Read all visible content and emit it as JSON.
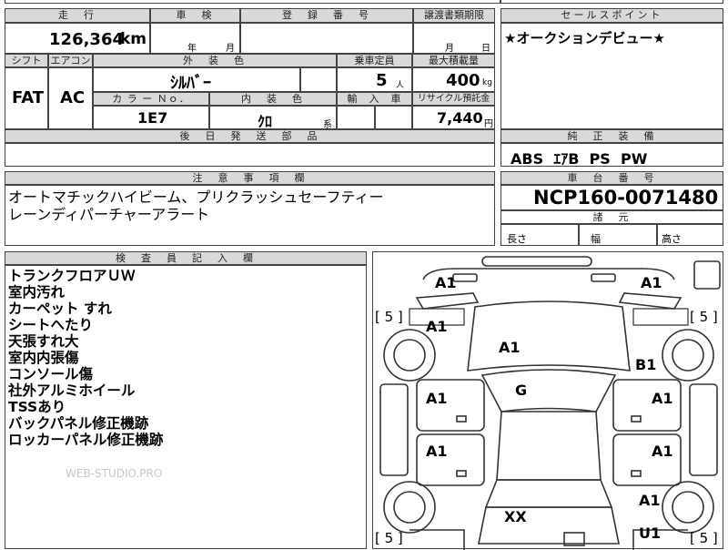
{
  "top_row": {
    "mileage_hdr": "走　行",
    "mileage_value": "126,364",
    "mileage_unit": "km",
    "shaken_hdr": "車　検",
    "shaken_year": "年",
    "shaken_month": "月",
    "reg_hdr": "登　録　番　号",
    "transfer_hdr": "譲渡書類期限",
    "transfer_month": "月",
    "transfer_day": "日"
  },
  "spec_row": {
    "shift_hdr": "シフト",
    "shift": "FAT",
    "ac_hdr": "エアコン",
    "ac": "AC",
    "ext_color_hdr": "外　装　色",
    "ext_color": "ｼﾙﾊﾞｰ",
    "seats_hdr": "乗車定員",
    "seats": "5",
    "seats_unit": "人",
    "load_hdr": "最大積載量",
    "load": "400",
    "load_unit": "kg",
    "color_no_hdr": "カ ラ ー Ｎｏ．",
    "color_no": "1E7",
    "int_color_hdr": "内　装　色",
    "int_color": "ｸﾛ",
    "int_color_unit": "系",
    "import_hdr": "輸　入　車",
    "recycle_hdr": "リサイクル預託金",
    "recycle": "7,440",
    "recycle_unit": "円",
    "parts_hdr": "後　日　発　送　部　品"
  },
  "sales_point": {
    "hdr": "セールスポイント",
    "text": "★オークションデビュー★"
  },
  "equipment": {
    "hdr": "純　正　装　備",
    "text": "ABS  ｴｱB  PS  PW"
  },
  "notes": {
    "hdr": "注　意　事　項　欄",
    "text": "オートマチックハイビーム、プリクラッシュセーフティー\nレーンディパーチャーアラート"
  },
  "chassis": {
    "hdr": "車　台　番　号",
    "value": "NCP160-0071480"
  },
  "dims": {
    "hdr": "諸　元",
    "length": "長さ",
    "width": "幅",
    "height": "高さ"
  },
  "inspector": {
    "hdr": "検　査　員　記　入　欄",
    "lines": [
      "トランクフロアＵＷ",
      "室内汚れ",
      "カーペット すれ",
      "シートへたり",
      "天張すれ大",
      "室内内張傷",
      "コンソール傷",
      "社外アルミホイール",
      "TSSあり",
      "バックパネル修正機跡",
      "ロッカーパネル修正機跡"
    ]
  },
  "watermark": "WEB-STUDIO.PRO",
  "diagram": {
    "marks": [
      {
        "label": "A1",
        "name": "mark-front-left-fender-top"
      },
      {
        "label": "A1",
        "name": "mark-front-right-fender-top"
      },
      {
        "label": "A1",
        "name": "mark-left-front-fender"
      },
      {
        "label": "A1",
        "name": "mark-hood"
      },
      {
        "label": "B1",
        "name": "mark-right-front-fender"
      },
      {
        "label": "G",
        "name": "mark-windshield"
      },
      {
        "label": "A1",
        "name": "mark-left-front-door"
      },
      {
        "label": "A1",
        "name": "mark-right-front-door"
      },
      {
        "label": "A1",
        "name": "mark-left-rear-door"
      },
      {
        "label": "A1",
        "name": "mark-right-rear-door"
      },
      {
        "label": "A1",
        "name": "mark-right-rear-fender"
      },
      {
        "label": "XX",
        "name": "mark-trunk"
      },
      {
        "label": "U1",
        "name": "mark-rear-bumper-right"
      }
    ],
    "tire_tl": "[ 5 ]",
    "tire_tr": "[ 5 ]",
    "tire_bl": "[ 5 ]",
    "tire_br": "[ 5 ]"
  }
}
